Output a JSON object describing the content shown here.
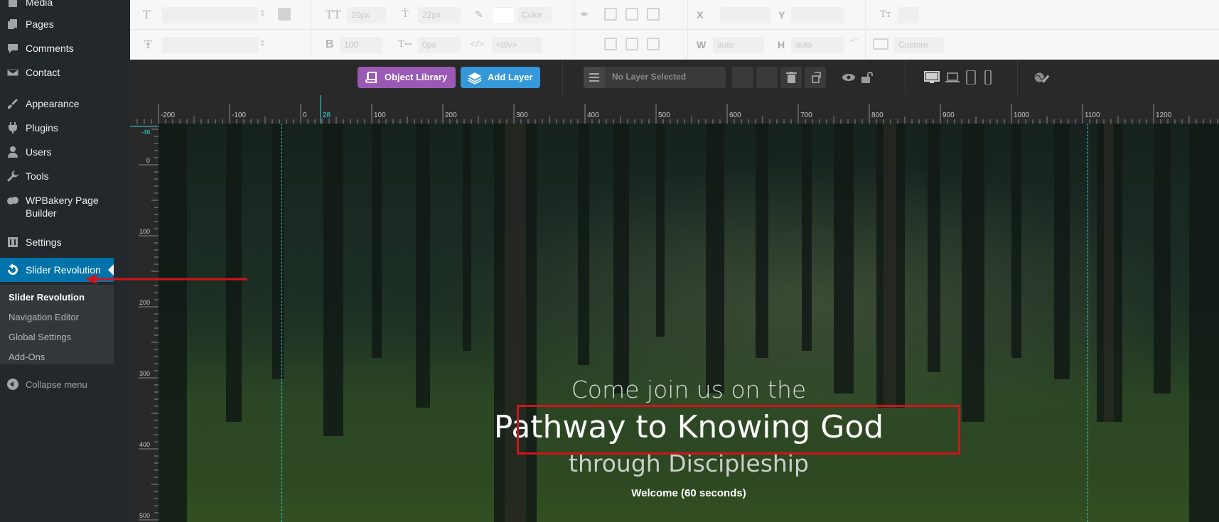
{
  "sidebar": {
    "items": [
      {
        "label": "Media",
        "icon": "media-icon"
      },
      {
        "label": "Pages",
        "icon": "pages-icon"
      },
      {
        "label": "Comments",
        "icon": "comments-icon"
      },
      {
        "label": "Contact",
        "icon": "mail-icon"
      },
      {
        "label": "Appearance",
        "icon": "paintbrush-icon"
      },
      {
        "label": "Plugins",
        "icon": "plugin-icon"
      },
      {
        "label": "Users",
        "icon": "users-icon"
      },
      {
        "label": "Tools",
        "icon": "wrench-icon"
      },
      {
        "label": "WPBakery Page Builder",
        "icon": "cloud-icon"
      },
      {
        "label": "Settings",
        "icon": "settings-icon"
      },
      {
        "label": "Slider Revolution",
        "icon": "refresh-icon"
      }
    ],
    "submenu": [
      "Slider Revolution",
      "Navigation Editor",
      "Global Settings",
      "Add-Ons"
    ],
    "collapse_label": "Collapse menu"
  },
  "toolbar": {
    "row1": {
      "font_family": "-",
      "font_size": "20px",
      "line_height": "22px",
      "color_label": "Color",
      "x_label": "X",
      "y_label": "Y"
    },
    "row2": {
      "font_weight": "100",
      "letter_spacing": "0px",
      "tag": "<div>",
      "w_label": "W",
      "w_value": "auto",
      "h_label": "H",
      "h_value": "auto",
      "size_mode": "Custom"
    }
  },
  "actionbar": {
    "object_library": "Object Library",
    "add_layer": "Add Layer",
    "layer_select": "No Layer Selected"
  },
  "ruler": {
    "h_marker": "28",
    "v_marker": "-46",
    "h_ticks": [
      "-200",
      "-100",
      "0",
      "100",
      "200",
      "300",
      "400",
      "500",
      "600",
      "700",
      "800",
      "900",
      "1000",
      "1100",
      "1200"
    ],
    "v_ticks": [
      "0",
      "100",
      "200",
      "300",
      "400",
      "500"
    ]
  },
  "slide": {
    "line1": "Come join us on the",
    "line2": "Pathway to Knowing God",
    "line3": "through Discipleship",
    "line4": "Welcome (60 seconds)"
  },
  "colors": {
    "sidebar_bg": "#23282d",
    "active_item": "#0073aa",
    "object_library_btn": "#9b59b6",
    "add_layer_btn": "#3498db",
    "guide": "#3ad3d1",
    "highlight": "#d0141a"
  }
}
